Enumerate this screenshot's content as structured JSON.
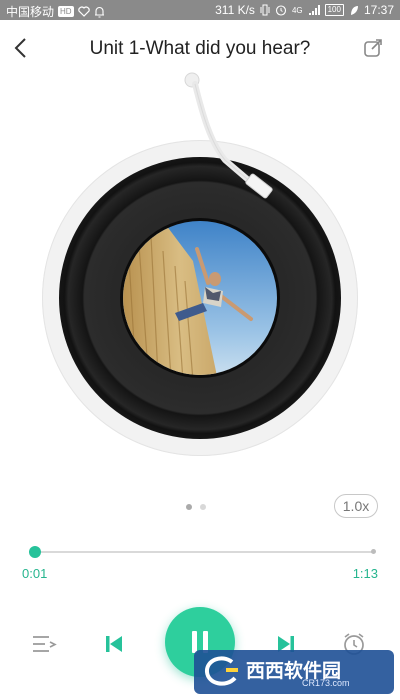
{
  "status_bar": {
    "carrier": "中国移动",
    "network_speed": "311 K/s",
    "network_type": "4G",
    "battery": "100",
    "time": "17:37"
  },
  "header": {
    "title": "Unit 1-What did you hear?",
    "back_icon": "chevron-left-icon",
    "share_icon": "share-icon"
  },
  "player": {
    "speed": "1.0x",
    "current_time": "0:01",
    "total_time": "1:13",
    "progress_fraction": 0.014,
    "page_count": 2,
    "active_page": 0,
    "accent_color": "#26c29a"
  },
  "controls": {
    "playlist_icon": "playlist-icon",
    "prev_icon": "skip-previous-icon",
    "play_icon": "pause-icon",
    "next_icon": "skip-next-icon",
    "timer_icon": "alarm-clock-icon"
  },
  "watermark": {
    "text": "西西软件园",
    "sub": "CR173.com"
  }
}
